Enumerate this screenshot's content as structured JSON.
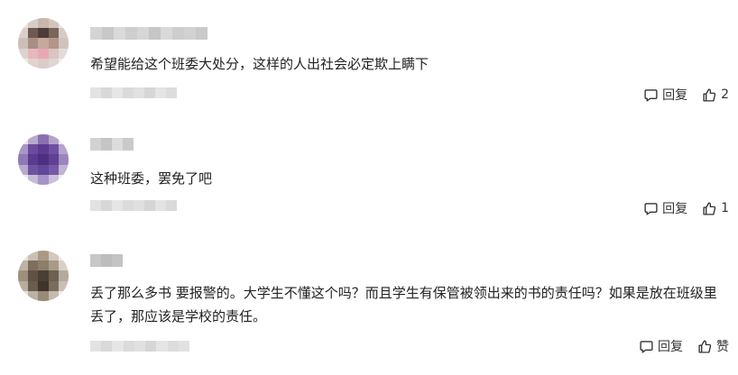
{
  "comments": [
    {
      "text": "希望能给这个班委大处分，这样的人出社会必定欺上瞒下",
      "reply_label": "回复",
      "like_label": "2"
    },
    {
      "text": "这种班委，罢免了吧",
      "reply_label": "回复",
      "like_label": "1"
    },
    {
      "text": "丢了那么多书 要报警的。大学生不懂这个吗？而且学生有保管被领出来的书的责任吗？如果是放在班级里丢了，那应该是学校的责任。",
      "reply_label": "回复",
      "like_label": "赞"
    }
  ],
  "icons": {
    "reply": "reply-bubble-icon",
    "like": "thumbs-up-icon"
  }
}
